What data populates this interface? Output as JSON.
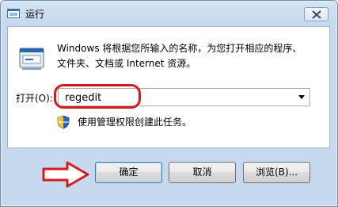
{
  "window": {
    "title": "运行",
    "app_icon": "run-icon",
    "close_icon": "close-icon"
  },
  "description": {
    "line1": "Windows 将根据您所输入的名称，为您打开相应的程序、",
    "line2": "文件夹、文档或 Internet 资源。",
    "icon": "run-dialog-icon"
  },
  "open_field": {
    "label": "打开(O):",
    "value": "regedit"
  },
  "admin_note": {
    "text": "使用管理权限创建此任务。",
    "icon": "uac-shield-icon"
  },
  "buttons": {
    "ok": "确定",
    "cancel": "取消",
    "browse": "浏览(B)..."
  },
  "annotation": {
    "color": "#d51a20"
  }
}
